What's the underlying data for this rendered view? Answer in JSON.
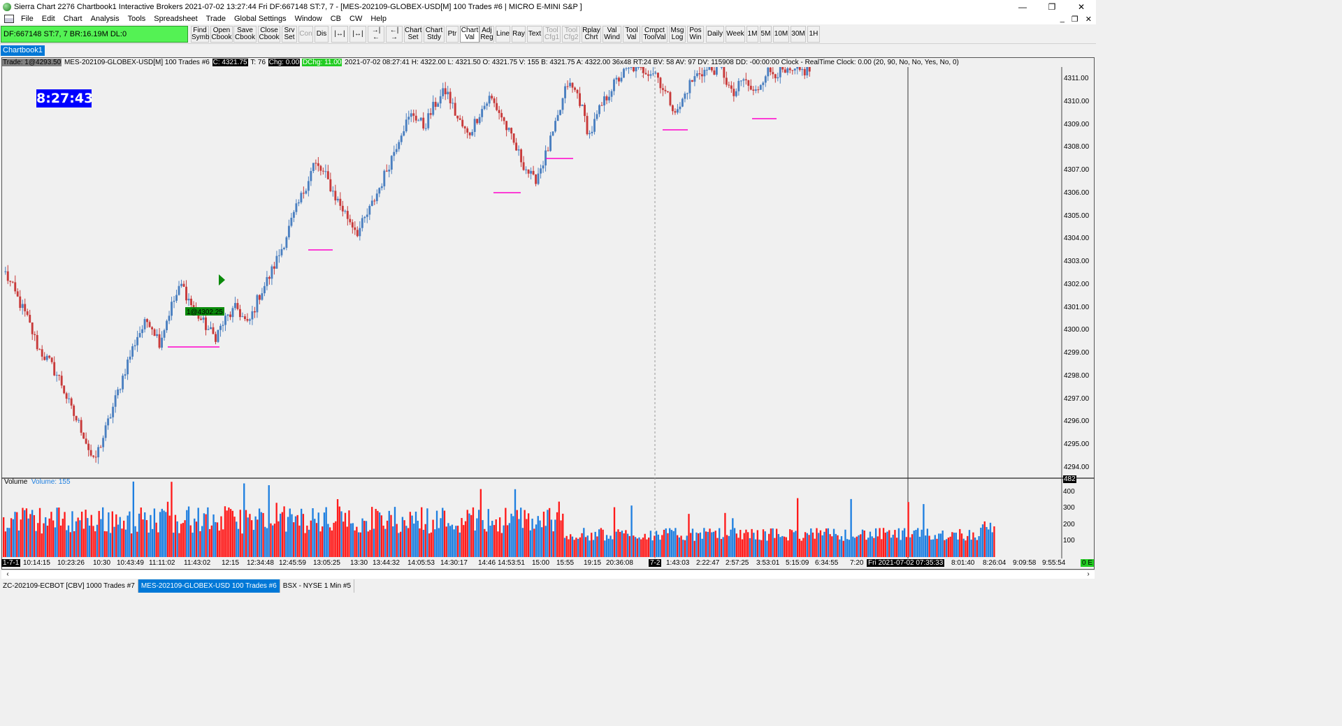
{
  "window": {
    "title": "Sierra Chart 2276 Chartbook1  Interactive Brokers 2021-07-02  13:27:44 Fri  DF:667148  ST:7, 7 - [MES-202109-GLOBEX-USD[M]  100 Trades  #6 | MICRO E-MINI S&P ]",
    "minimize": "—",
    "restore": "❐",
    "close": "✕"
  },
  "menu": {
    "items": [
      "File",
      "Edit",
      "Chart",
      "Analysis",
      "Tools",
      "Spreadsheet",
      "Trade",
      "Global Settings",
      "Window",
      "CB",
      "CW",
      "Help"
    ],
    "right": [
      "_",
      "❐",
      "✕"
    ]
  },
  "toolbar": {
    "account": "DF:667148  ST:7, 7  BR:16.19M  DL:0",
    "buttons": [
      {
        "label": "Find\nSymb",
        "state": "normal"
      },
      {
        "label": "Open\nCbook",
        "state": "normal"
      },
      {
        "label": "Save\nCbook",
        "state": "normal"
      },
      {
        "label": "Close\nCbook",
        "state": "normal"
      },
      {
        "label": "Srv\nSet",
        "state": "normal"
      },
      {
        "label": "Con",
        "state": "disabled"
      },
      {
        "label": "Dis",
        "state": "normal"
      },
      {
        "label": "|↔|",
        "state": "normal"
      },
      {
        "label": "|↔|",
        "state": "normal"
      },
      {
        "label": "→|←",
        "state": "normal"
      },
      {
        "label": "←|→",
        "state": "normal"
      },
      {
        "label": "Chart\nSet",
        "state": "normal"
      },
      {
        "label": "Chart\nStdy",
        "state": "normal"
      },
      {
        "label": "Ptr",
        "state": "normal"
      },
      {
        "label": "Chart\nVal",
        "state": "active"
      },
      {
        "label": "Adj\nReg",
        "state": "normal"
      },
      {
        "label": "Line",
        "state": "normal"
      },
      {
        "label": "Ray",
        "state": "normal"
      },
      {
        "label": "Text",
        "state": "normal"
      },
      {
        "label": "Tool\nCfg1",
        "state": "disabled"
      },
      {
        "label": "Tool\nCfg2",
        "state": "disabled"
      },
      {
        "label": "Rplay\nChrt",
        "state": "normal"
      },
      {
        "label": "Val\nWind",
        "state": "normal"
      },
      {
        "label": "Tool\nVal",
        "state": "normal"
      },
      {
        "label": "Cmpct\nToolVal",
        "state": "normal"
      },
      {
        "label": "Msg\nLog",
        "state": "normal"
      },
      {
        "label": "Pos\nWin",
        "state": "normal"
      },
      {
        "label": "Daily",
        "state": "normal"
      },
      {
        "label": "Week",
        "state": "normal"
      },
      {
        "label": "1M",
        "state": "normal"
      },
      {
        "label": "5M",
        "state": "normal"
      },
      {
        "label": "10M",
        "state": "normal"
      },
      {
        "label": "30M",
        "state": "normal"
      },
      {
        "label": "1H",
        "state": "normal"
      }
    ]
  },
  "chartbook_tab": "Chartbook1",
  "info_line": {
    "trade": "Trade: 1@4293.50",
    "symbol": "MES-202109-GLOBEX-USD[M]  100 Trades  #6",
    "close": "C: 4321.75",
    "t": "T: 76",
    "chg": "Chg: 0.00",
    "dchg": "DChg: 11.00",
    "rest": "2021-07-02 08:27:41  H: 4322.00  L: 4321.50  O: 4321.75  V: 155  B: 4321.75  A: 4322.00  36x48  RT:24  BV: 58  AV: 97  DV: 115908  DD: -00:00:00  Clock - RealTime  Clock: 0.00   (20, 90, No, No, Yes, No, 0)"
  },
  "clock": "8:27:43",
  "position_label": "1@4302.25",
  "volume": {
    "title": "Volume",
    "value": "Volume: 155",
    "current_label": "482",
    "axis_labels": [
      "400",
      "300",
      "200",
      "100"
    ]
  },
  "price_axis": [
    "4311.00",
    "4310.00",
    "4309.00",
    "4308.00",
    "4307.00",
    "4306.00",
    "4305.00",
    "4304.00",
    "4303.00",
    "4302.00",
    "4301.00",
    "4300.00",
    "4299.00",
    "4298.00",
    "4297.00",
    "4296.00",
    "4295.00",
    "4294.00"
  ],
  "time_axis": {
    "left_date": "1-7-1",
    "mid_date": "7-2",
    "cursor_label": "Fri 2021-07-02  07:35:33",
    "scale_label": "0 E",
    "ticks": [
      "10:14:15",
      "10:23:26",
      "10:30",
      "10:43:49",
      "11:11:02",
      "11:43:02",
      "12:15",
      "12:34:48",
      "12:45:59",
      "13:05:25",
      "13:30",
      "13:44:32",
      "14:05:53",
      "14:30:17",
      "14:46",
      "14:53:51",
      "15:00",
      "15:55",
      "19:15",
      "20:36:08",
      "1:43:03",
      "2:22:47",
      "2:57:25",
      "3:53:01",
      "5:15:09",
      "6:34:55",
      "7:20",
      "8:01:40",
      "8:26:04",
      "9:09:58",
      "9:55:54"
    ]
  },
  "bottom_tabs": [
    {
      "label": "ZC-202109-ECBOT [CBV]  1000 Trades  #7",
      "active": false
    },
    {
      "label": "MES-202109-GLOBEX-USD  100 Trades  #6",
      "active": true
    },
    {
      "label": "BSX - NYSE  1 Min  #5",
      "active": false
    }
  ],
  "colors": {
    "up_bar": "#4a7fc0",
    "down_bar": "#c83a3a",
    "vol_up": "#1e7fe0",
    "vol_down": "#ff1a1a",
    "low_marker": "#ff00cc",
    "clock_bg": "#0000ff"
  },
  "chart_data": {
    "type": "candlestick",
    "y_axis_range": [
      4294.0,
      4311.0
    ],
    "volume_axis_range": [
      0,
      482
    ],
    "swing_low_markers": [
      4300.0,
      4304.0,
      4306.0,
      4307.5,
      4309.25,
      4309.75
    ],
    "price_path": [
      4302.5,
      4301.5,
      4300.5,
      4299.2,
      4298.6,
      4297.8,
      4296.5,
      4295.6,
      4294.2,
      4295.5,
      4297.0,
      4298.5,
      4299.8,
      4300.5,
      4299.5,
      4301.0,
      4302.0,
      4301.0,
      4300.3,
      4299.7,
      4300.5,
      4301.0,
      4300.2,
      4301.5,
      4302.4,
      4303.5,
      4304.8,
      4306.0,
      4307.3,
      4306.8,
      4305.8,
      4305.0,
      4304.3,
      4305.2,
      4306.3,
      4307.5,
      4308.8,
      4309.5,
      4308.9,
      4309.9,
      4310.5,
      4309.3,
      4308.5,
      4309.5,
      4310.2,
      4309.4,
      4308.3,
      4307.3,
      4306.5,
      4307.6,
      4309.0,
      4310.8,
      4310.3,
      4308.5,
      4309.7,
      4310.6,
      4311.2,
      4311.5,
      4311.4,
      4311.3,
      4310.3,
      4309.5,
      4310.7,
      4311.3,
      4311.4,
      4311.5,
      4310.2,
      4311.0,
      4310.3,
      4311.3,
      4311.3,
      4311.2,
      4311.3,
      4311.4
    ]
  }
}
